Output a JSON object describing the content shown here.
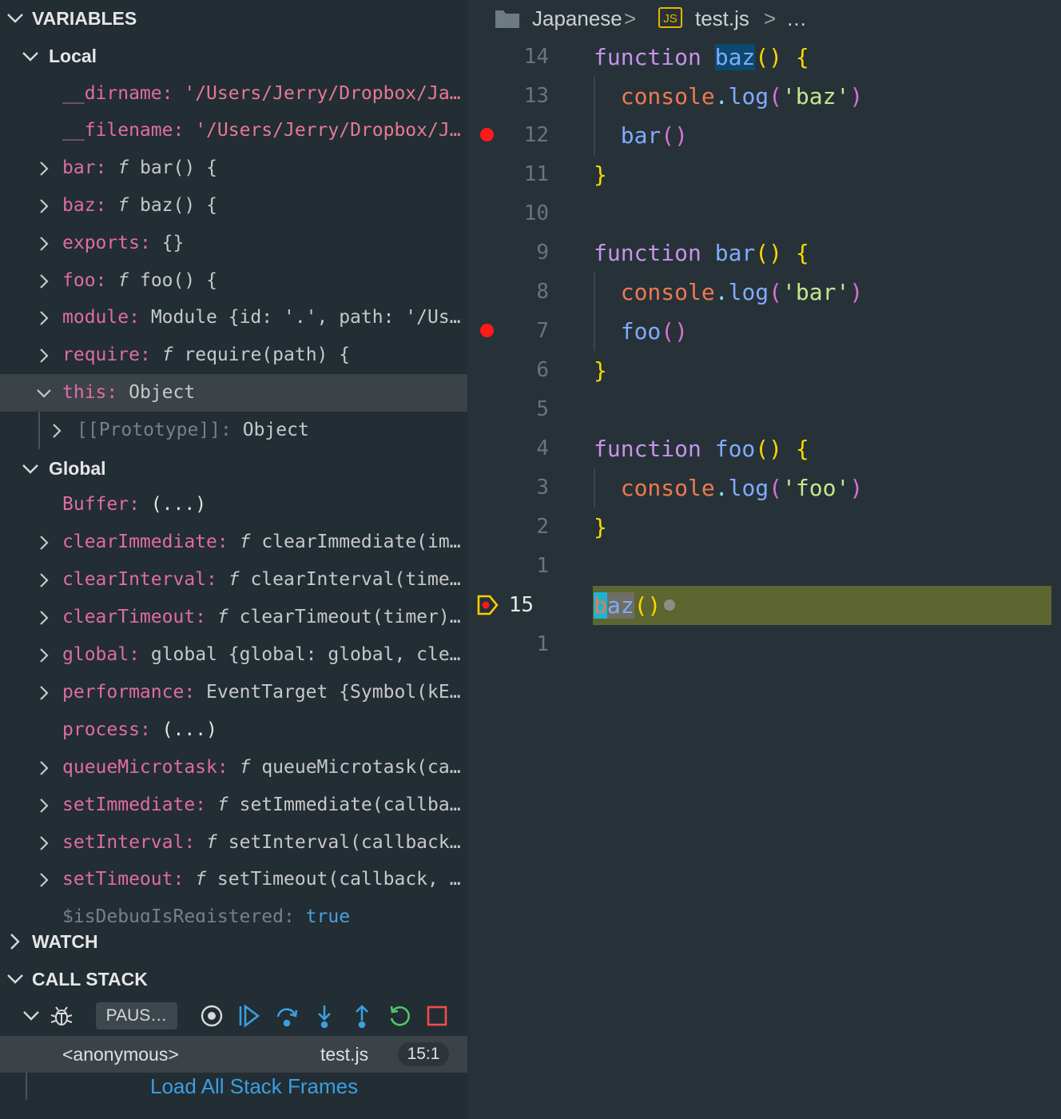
{
  "sidebar": {
    "variables_header": "VARIABLES",
    "local_label": "Local",
    "global_label": "Global",
    "local_vars": [
      {
        "name": "__dirname",
        "value": "'/Users/Jerry/Dropbox/Ja…"
      },
      {
        "name": "__filename",
        "value": "'/Users/Jerry/Dropbox/J…"
      },
      {
        "name": "bar",
        "value": "bar() {"
      },
      {
        "name": "baz",
        "value": "baz() {"
      },
      {
        "name": "exports",
        "value": "{}"
      },
      {
        "name": "foo",
        "value": "foo() {"
      },
      {
        "name": "module",
        "value": "Module {id: '.', path: '/Us…"
      },
      {
        "name": "require",
        "value": "require(path) {"
      },
      {
        "name": "this",
        "value": "Object"
      },
      {
        "name": "[[Prototype]]",
        "value": "Object"
      }
    ],
    "global_vars": [
      {
        "name": "Buffer",
        "value": "(...)"
      },
      {
        "name": "clearImmediate",
        "value": "clearImmediate(im…"
      },
      {
        "name": "clearInterval",
        "value": "clearInterval(time…"
      },
      {
        "name": "clearTimeout",
        "value": "clearTimeout(timer)…"
      },
      {
        "name": "global",
        "value": "global {global: global, cle…"
      },
      {
        "name": "performance",
        "value": "EventTarget {Symbol(kE…"
      },
      {
        "name": "process",
        "value": "(...)"
      },
      {
        "name": "queueMicrotask",
        "value": "queueMicrotask(ca…"
      },
      {
        "name": "setImmediate",
        "value": "setImmediate(callba…"
      },
      {
        "name": "setInterval",
        "value": "setInterval(callback…"
      },
      {
        "name": "setTimeout",
        "value": "setTimeout(callback, …"
      },
      {
        "name": "$isDebugIsRegistered",
        "value": "true"
      }
    ],
    "function_glyph": "f",
    "name_separator": ":",
    "watch_header": "WATCH",
    "callstack_header": "CALL STACK",
    "paused_label": "PAUS…",
    "stack_frame": {
      "name": "<anonymous>",
      "file": "test.js",
      "position": "15:1"
    },
    "load_all_label": "Load All Stack Frames"
  },
  "editor": {
    "breadcrumb": {
      "folder": "Japanese",
      "sep": ">",
      "file_icon": "JS",
      "file": "test.js",
      "more": "…"
    },
    "line_numbers": [
      "14",
      "13",
      "12",
      "11",
      "10",
      "9",
      "8",
      "7",
      "6",
      "5",
      "4",
      "3",
      "2",
      "1",
      "15",
      "1"
    ],
    "code": {
      "kw_function": "function",
      "fn_baz": "baz",
      "fn_bar": "bar",
      "fn_foo": "foo",
      "console": "console",
      "dot": ".",
      "log": "log",
      "open_paren": "(",
      "close_paren": ")",
      "parens": "()",
      "open_brace": "{",
      "close_brace": "}",
      "str_baz": "'baz'",
      "str_bar": "'bar'",
      "str_foo": "'foo'",
      "call_b": "b",
      "call_az": "az"
    }
  },
  "colors": {
    "accent": "#3a9fe0",
    "breakpoint": "#ff1a1a",
    "current_line": "#5d6531"
  },
  "icons": [
    "chevron-down-icon",
    "chevron-right-icon",
    "folder-icon",
    "js-file-icon",
    "bug-icon",
    "breakpoints-icon",
    "continue-icon",
    "step-over-icon",
    "step-into-icon",
    "step-out-icon",
    "restart-icon",
    "stop-icon",
    "breakpoint-dot-icon",
    "current-frame-icon"
  ]
}
